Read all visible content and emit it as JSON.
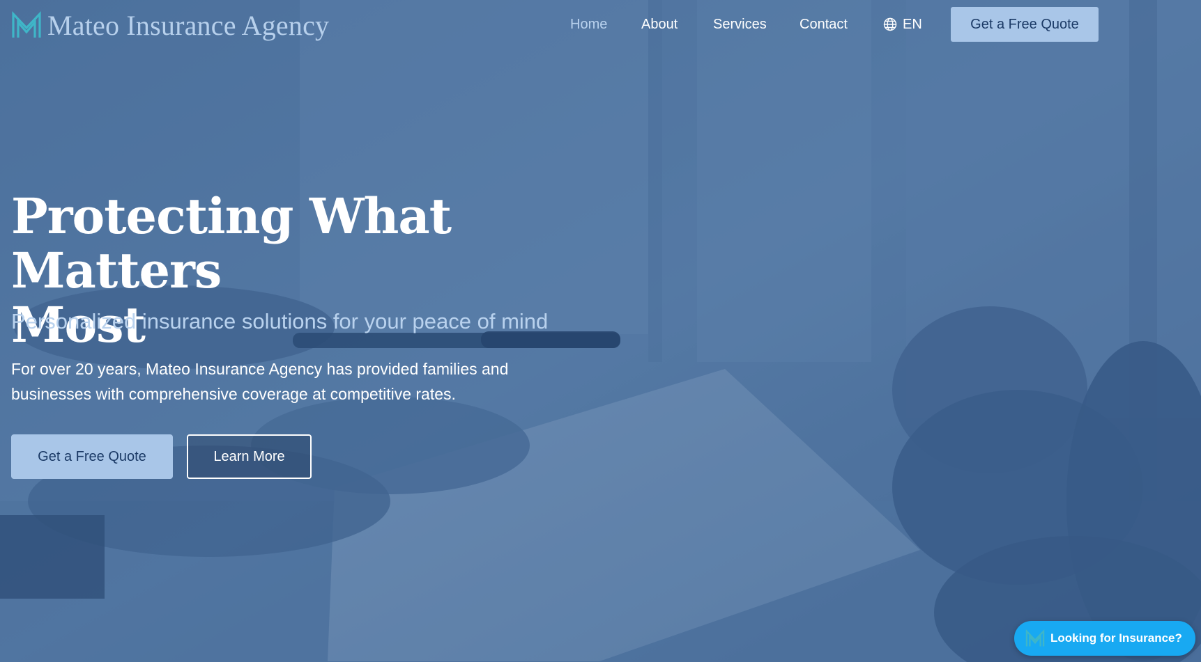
{
  "brand": {
    "name": "Mateo Insurance Agency",
    "logo_icon": "m-monogram-icon"
  },
  "nav": {
    "items": [
      {
        "label": "Home",
        "active": true
      },
      {
        "label": "About",
        "active": false
      },
      {
        "label": "Services",
        "active": false
      },
      {
        "label": "Contact",
        "active": false
      }
    ],
    "language": {
      "label": "EN",
      "icon": "globe-icon"
    },
    "cta_label": "Get a Free Quote"
  },
  "hero": {
    "background_image": "business-meeting-signing-document",
    "title_line1": "Protecting What Matters",
    "title_line2": "Most",
    "subtitle": "Personalized insurance solutions for your peace of mind",
    "description_line1": "For over 20 years, Mateo Insurance Agency has provided families and",
    "description_line2": "businesses with comprehensive coverage at competitive rates.",
    "primary_button": "Get a Free Quote",
    "secondary_button": "Learn More"
  },
  "chat_widget": {
    "label": "Looking for Insurance?",
    "icon": "m-monogram-icon"
  },
  "colors": {
    "overlay": "#345c8e",
    "accent_light": "#a9c6e8",
    "accent_text": "#b9d2ee",
    "button_text_dark": "#1b3a66",
    "chat_blue": "#18a9f2",
    "logo_teal": "#3fb6c8"
  }
}
